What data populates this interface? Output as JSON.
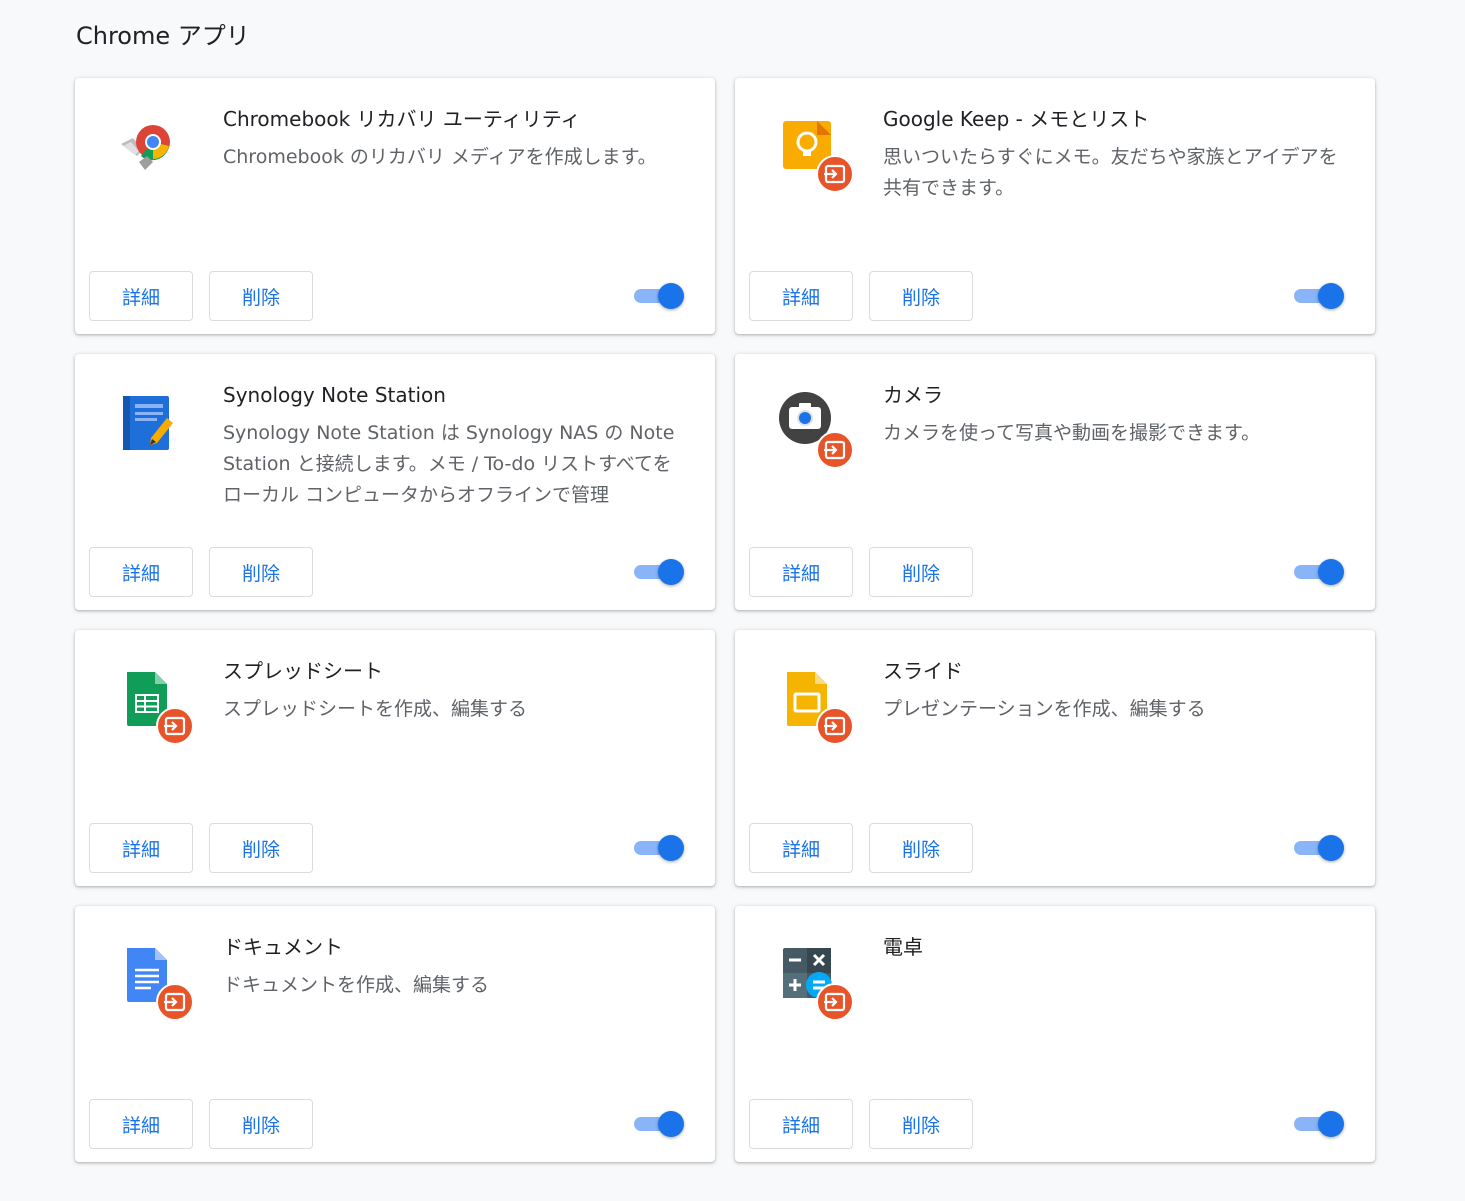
{
  "section": {
    "title": "Chrome アプリ"
  },
  "colors": {
    "accent": "#1a73e8",
    "badge": "#e8542a",
    "toggle_track": "#8ab4f8"
  },
  "apps": [
    {
      "name": "Chromebook リカバリ ユーティリティ",
      "description": "Chromebook のリカバリ メディアを作成します。",
      "icon": "chromebook-recovery-icon",
      "shortcut_badge": false,
      "details_label": "詳細",
      "remove_label": "削除",
      "enabled": true
    },
    {
      "name": "Google Keep - メモとリスト",
      "description": "思いついたらすぐにメモ。友だちや家族とアイデアを共有できます。",
      "icon": "google-keep-icon",
      "shortcut_badge": true,
      "details_label": "詳細",
      "remove_label": "削除",
      "enabled": true
    },
    {
      "name": "Synology Note Station",
      "description": "Synology Note Station は Synology NAS の Note Station と接続します。メモ / To-do リストすべてをローカル コンピュータからオフラインで管理",
      "icon": "synology-note-station-icon",
      "shortcut_badge": false,
      "details_label": "詳細",
      "remove_label": "削除",
      "enabled": true
    },
    {
      "name": "カメラ",
      "description": "カメラを使って写真や動画を撮影できます。",
      "icon": "camera-icon",
      "shortcut_badge": true,
      "details_label": "詳細",
      "remove_label": "削除",
      "enabled": true
    },
    {
      "name": "スプレッドシート",
      "description": "スプレッドシートを作成、編集する",
      "icon": "sheets-icon",
      "shortcut_badge": true,
      "details_label": "詳細",
      "remove_label": "削除",
      "enabled": true
    },
    {
      "name": "スライド",
      "description": "プレゼンテーションを作成、編集する",
      "icon": "slides-icon",
      "shortcut_badge": true,
      "details_label": "詳細",
      "remove_label": "削除",
      "enabled": true
    },
    {
      "name": "ドキュメント",
      "description": "ドキュメントを作成、編集する",
      "icon": "docs-icon",
      "shortcut_badge": true,
      "details_label": "詳細",
      "remove_label": "削除",
      "enabled": true
    },
    {
      "name": "電卓",
      "description": "",
      "icon": "calculator-icon",
      "shortcut_badge": true,
      "details_label": "詳細",
      "remove_label": "削除",
      "enabled": true
    }
  ]
}
